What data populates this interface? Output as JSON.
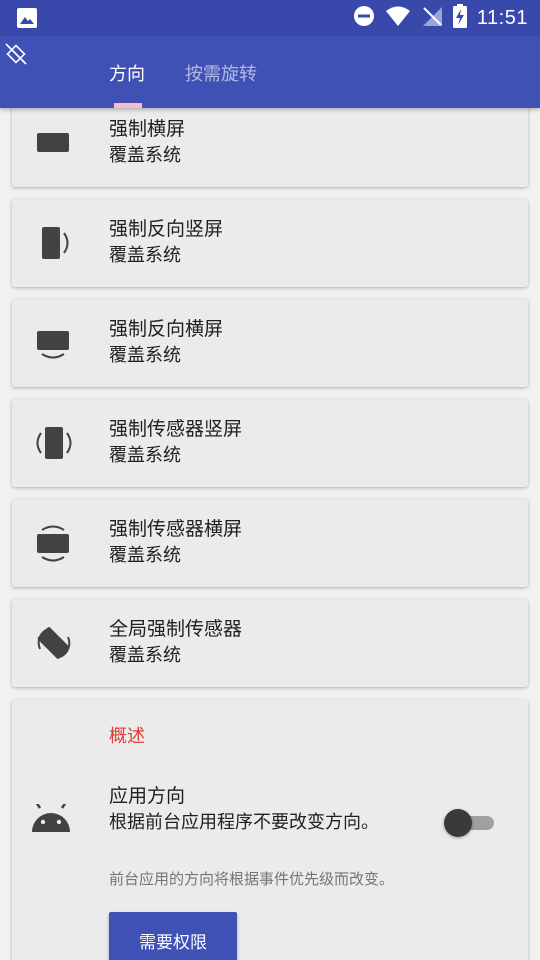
{
  "status_bar": {
    "time": "11:51"
  },
  "tabs": [
    {
      "label": "方向",
      "active": true
    },
    {
      "label": "按需旋转",
      "active": false
    }
  ],
  "options": [
    {
      "title": "强制横屏",
      "subtitle": "覆盖系统",
      "icon": "landscape-icon"
    },
    {
      "title": "强制反向竖屏",
      "subtitle": "覆盖系统",
      "icon": "reverse-portrait-icon"
    },
    {
      "title": "强制反向横屏",
      "subtitle": "覆盖系统",
      "icon": "reverse-landscape-icon"
    },
    {
      "title": "强制传感器竖屏",
      "subtitle": "覆盖系统",
      "icon": "sensor-portrait-icon"
    },
    {
      "title": "强制传感器横屏",
      "subtitle": "覆盖系统",
      "icon": "sensor-landscape-icon"
    },
    {
      "title": "全局强制传感器",
      "subtitle": "覆盖系统",
      "icon": "full-sensor-icon"
    }
  ],
  "overview": {
    "section_title": "概述",
    "pref_title": "应用方向",
    "pref_summary": "根据前台应用程序不要改变方向。",
    "pref_note": "前台应用的方向将根据事件优先级而改变。",
    "switch_on": false,
    "button_label": "需要权限"
  },
  "colors": {
    "status_bar": "#3949AB",
    "app_bar": "#3F51B5",
    "tab_indicator": "#F8BBD0",
    "section_title": "#E53935"
  }
}
